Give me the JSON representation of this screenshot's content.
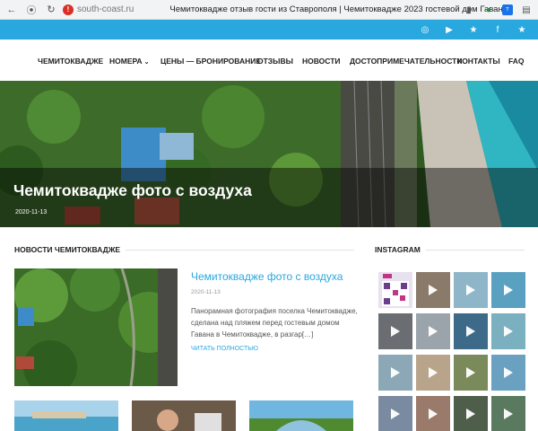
{
  "browser": {
    "domain": "south-coast.ru",
    "page_title": "Чемитокваджe отзыв гости из Ставрополя | Чемитокваджe 2023 гостевой дом Гавана"
  },
  "topbar": {
    "icons": [
      "instagram-icon",
      "youtube-icon",
      "star-icon",
      "facebook-icon",
      "star-icon"
    ]
  },
  "nav": {
    "items": [
      {
        "label": "ЧЕМИТОКВАДЖЕ"
      },
      {
        "label": "НОМЕРА",
        "has_dropdown": true
      },
      {
        "label": "ЦЕНЫ — БРОНИРОВАНИЕ"
      },
      {
        "label": "ОТЗЫВЫ"
      },
      {
        "label": "НОВОСТИ"
      },
      {
        "label": "ДОСТОПРИМЕЧАТЕЛЬНОСТИ"
      },
      {
        "label": "КОНТАКТЫ"
      },
      {
        "label": "FAQ"
      }
    ]
  },
  "hero": {
    "title": "Чемитокваджe фото с воздуха",
    "date": "2020-11-13"
  },
  "news": {
    "heading": "НОВОСТИ ЧЕМИТОКВАДЖЕ",
    "post": {
      "title": "Чемитокваджe фото с воздуха",
      "date": "2020-11-13",
      "excerpt": "Панорамная фотография поселка Чемитокваджe, сделана над пляжем перед гостевым домом Гавана в Чемитокваджe, в разгар[…]",
      "more": "ЧИТАТЬ ПОЛНОСТЬЮ"
    }
  },
  "instagram": {
    "heading": "INSTAGRAM",
    "cells": [
      {
        "kind": "qr"
      },
      {
        "kind": "video"
      },
      {
        "kind": "video"
      },
      {
        "kind": "video"
      },
      {
        "kind": "video"
      },
      {
        "kind": "video"
      },
      {
        "kind": "video"
      },
      {
        "kind": "video"
      },
      {
        "kind": "video"
      },
      {
        "kind": "video"
      },
      {
        "kind": "video"
      },
      {
        "kind": "video"
      },
      {
        "kind": "video"
      },
      {
        "kind": "video"
      },
      {
        "kind": "video"
      },
      {
        "kind": "video"
      }
    ]
  },
  "colors": {
    "accent": "#29a8df",
    "hero_overlay": "#000000"
  }
}
